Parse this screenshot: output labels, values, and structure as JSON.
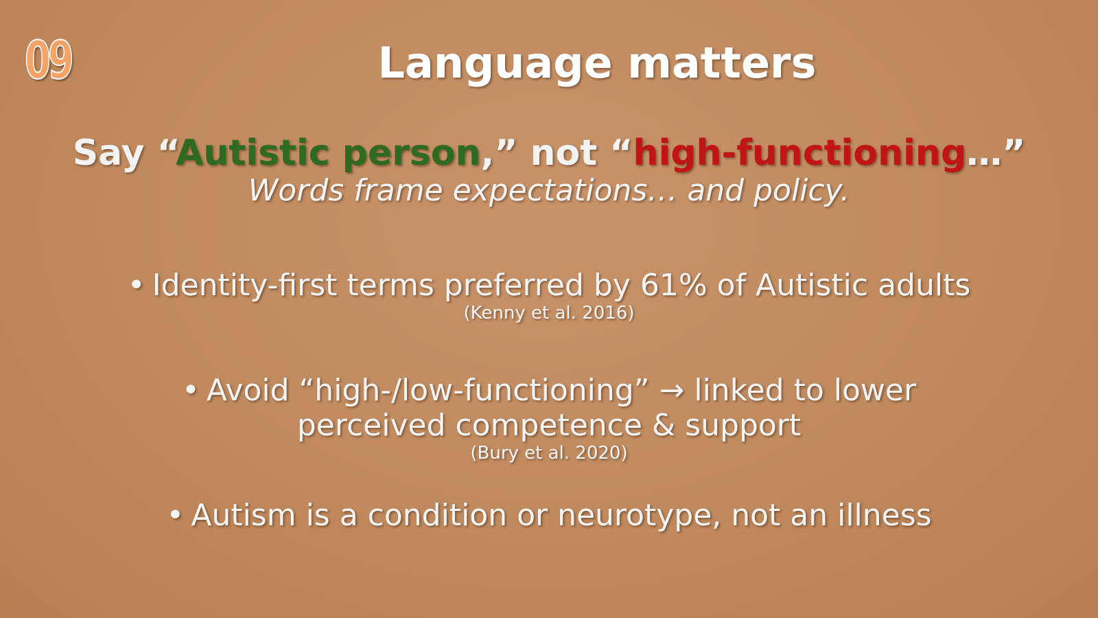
{
  "slide": {
    "number": "09",
    "title": "Language matters",
    "headline": {
      "say": "Say “",
      "preferred": "Autistic person",
      "middle": ",” not “",
      "avoid": "high-functioning",
      "end": "…”"
    },
    "subline": "Words frame expectations… and policy.",
    "bullets": [
      {
        "bullet_char": "•",
        "text": "Identity-first terms preferred by 61% of Autistic adults",
        "citation": "(Kenny et al. 2016)"
      },
      {
        "bullet_char": "•",
        "line1": "Avoid “high-/low-functioning” → linked to lower",
        "line2": "perceived competence & support",
        "citation": "(Bury et al. 2020)"
      },
      {
        "bullet_char": "•",
        "text": "Autism is a condition or neurotype, not an illness"
      }
    ]
  },
  "colors": {
    "background": "#c08a5e",
    "number_fill": "#f5a366",
    "preferred_term": "#2f6a23",
    "avoided_term": "#c11414",
    "text": "#f5f5f5"
  }
}
